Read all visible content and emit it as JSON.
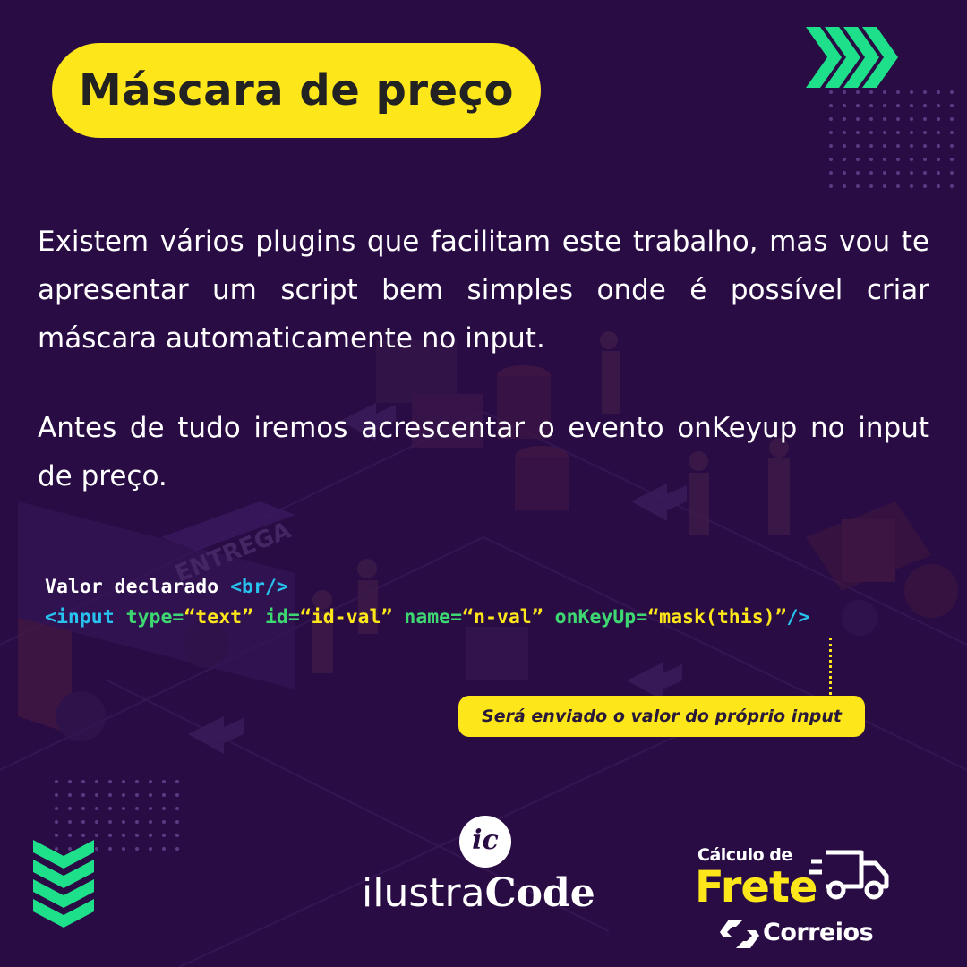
{
  "title": "Máscara de preço",
  "paragraphs": {
    "intro": "Existem vários plugins que facilitam este trabalho, mas vou te apresentar um script bem simples onde é possível criar máscara automaticamente no input.",
    "step": "Antes de tudo iremos acrescentar o evento onKeyup no input de preço."
  },
  "code": {
    "line1": "Valor declarado ",
    "line1_tag": "<br/>",
    "open_tag": "<input",
    "attr_type": "type=",
    "val_type": "“text”",
    "attr_id": "id=",
    "val_id": "“id-val”",
    "attr_name": "name=",
    "val_name": "“n-val”",
    "attr_onkeyup": "onKeyUp=",
    "val_onkeyup": "“mask(this)”",
    "close_tag": "/>"
  },
  "callout": "Será enviado o valor do próprio input",
  "background_sign": "ENTREGA",
  "brand": {
    "mark": "ic",
    "name_light": "ilustra",
    "name_bold": "Code"
  },
  "partner": {
    "calc_label": "Cálculo de",
    "frete": "Frete",
    "correios": "Correios"
  },
  "colors": {
    "background": "#2a0c45",
    "accent_yellow": "#fde61a",
    "accent_green": "#1fe08a",
    "code_tag": "#27c3ee",
    "code_attr": "#3ed872"
  },
  "icons": [
    "chevrons-right-icon",
    "chevrons-down-icon",
    "truck-icon",
    "correios-logo-icon"
  ]
}
